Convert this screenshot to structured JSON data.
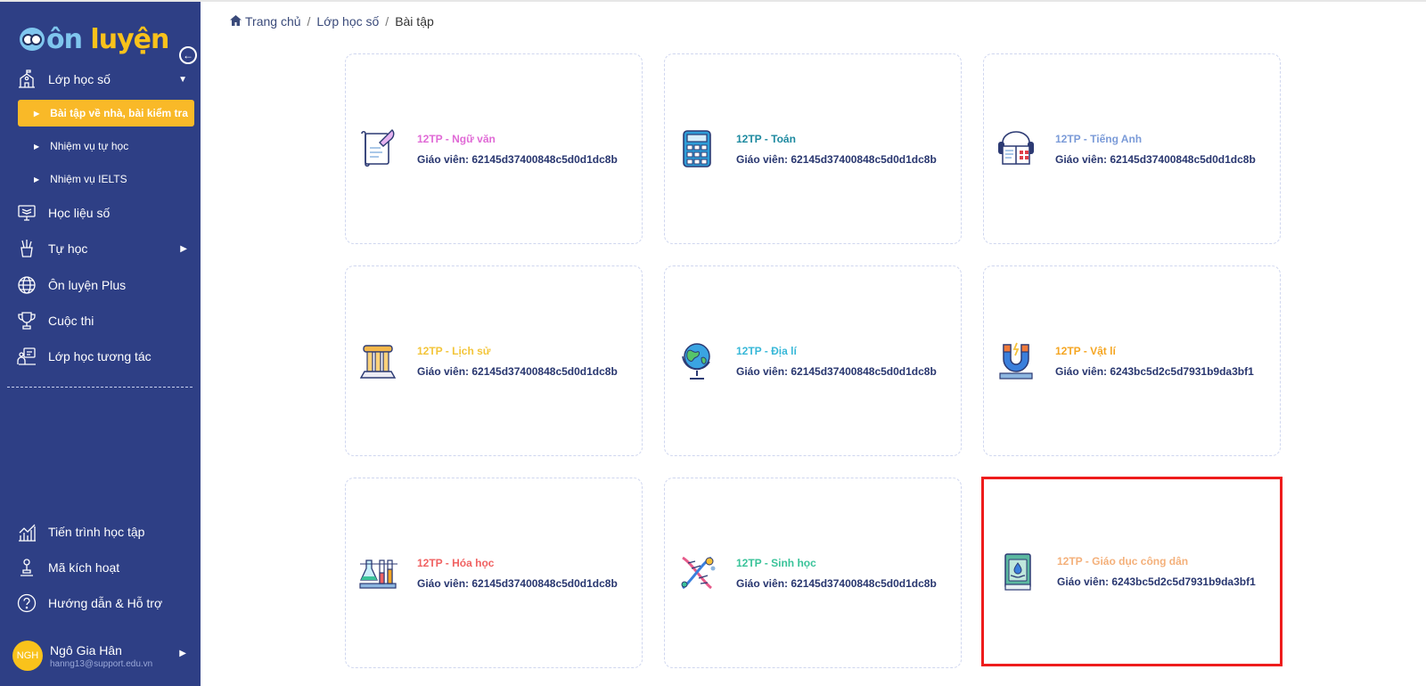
{
  "brand": {
    "logo_prefix": "ôn",
    "logo_suffix": "luyện"
  },
  "sidebar": {
    "menu": [
      {
        "label": "Lớp học số",
        "icon": "school-icon"
      },
      {
        "label": "Học liệu số",
        "icon": "monitor-book-icon"
      },
      {
        "label": "Tự học",
        "icon": "pencil-cup-icon"
      },
      {
        "label": "Ôn luyện Plus",
        "icon": "globe-icon"
      },
      {
        "label": "Cuộc thi",
        "icon": "trophy-icon"
      },
      {
        "label": "Lớp học tương tác",
        "icon": "interactive-class-icon"
      }
    ],
    "sub": [
      {
        "label": "Bài tập về nhà, bài kiểm tra",
        "active": true
      },
      {
        "label": "Nhiệm vụ tự học"
      },
      {
        "label": "Nhiệm vụ IELTS"
      }
    ],
    "bottom": [
      {
        "label": "Tiến trình học tập",
        "icon": "progress-chart-icon"
      },
      {
        "label": "Mã kích hoạt",
        "icon": "activation-key-icon"
      },
      {
        "label": "Hướng dẫn & Hỗ trợ",
        "icon": "help-icon"
      }
    ],
    "user": {
      "initials": "NGH",
      "name": "Ngô Gia Hân",
      "email": "hanng13@support.edu.vn"
    }
  },
  "breadcrumb": {
    "home": "Trang chủ",
    "level2": "Lớp học số",
    "current": "Bài tập"
  },
  "courses": [
    {
      "title": "12TP - Ngữ văn",
      "teacher": "Giáo viên: 62145d37400848c5d0d1dc8b",
      "color": "#e06ad6",
      "icon": "scroll-quill-icon"
    },
    {
      "title": "12TP - Toán",
      "teacher": "Giáo viên: 62145d37400848c5d0d1dc8b",
      "color": "#1e8aa0",
      "icon": "calculator-icon"
    },
    {
      "title": "12TP - Tiếng Anh",
      "teacher": "Giáo viên: 62145d37400848c5d0d1dc8b",
      "color": "#7b9bd8",
      "icon": "english-book-icon"
    },
    {
      "title": "12TP - Lịch sử",
      "teacher": "Giáo viên: 62145d37400848c5d0d1dc8b",
      "color": "#f3c53a",
      "icon": "column-pillar-icon"
    },
    {
      "title": "12TP - Địa lí",
      "teacher": "Giáo viên: 62145d37400848c5d0d1dc8b",
      "color": "#38b8d8",
      "icon": "globe-icon"
    },
    {
      "title": "12TP - Vật lí",
      "teacher": "Giáo viên: 6243bc5d2c5d7931b9da3bf1",
      "color": "#f5a623",
      "icon": "magnet-icon"
    },
    {
      "title": "12TP - Hóa học",
      "teacher": "Giáo viên: 62145d37400848c5d0d1dc8b",
      "color": "#f06262",
      "icon": "flask-icon"
    },
    {
      "title": "12TP - Sinh học",
      "teacher": "Giáo viên: 62145d37400848c5d0d1dc8b",
      "color": "#3ac39a",
      "icon": "dna-icon"
    },
    {
      "title": "12TP - Giáo dục công dân",
      "teacher": "Giáo viên: 6243bc5d2c5d7931b9da3bf1",
      "color": "#f4b07a",
      "icon": "civic-book-icon",
      "selected": true
    }
  ]
}
